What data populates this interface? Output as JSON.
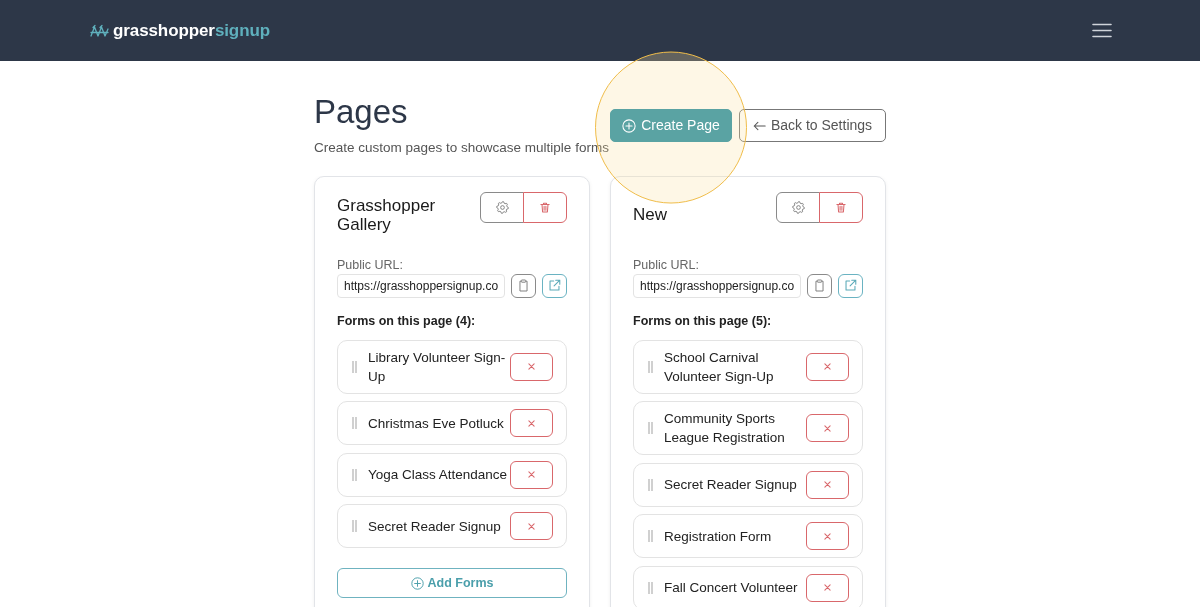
{
  "navbar": {
    "brand": {
      "name": "grasshopper",
      "suffix": "signup"
    }
  },
  "header": {
    "title": "Pages",
    "subtitle": "Create custom pages to showcase multiple forms",
    "actions": [
      {
        "label": "Create Page",
        "kind": "primary",
        "highlighted": true
      },
      {
        "label": "Back to Settings",
        "kind": "back",
        "highlighted": false
      }
    ]
  },
  "pages": [
    {
      "title": "Grasshopper Gallery",
      "url_label": "Public URL:",
      "url": "https://grasshoppersignup.co",
      "forms_heading": "Forms on this page (4):",
      "forms": [
        "Library Volunteer Sign-Up",
        "Christmas Eve Potluck",
        "Yoga Class Attendance",
        "Secret Reader Signup"
      ],
      "add_button": "Add Forms"
    },
    {
      "title": "New",
      "url_label": "Public URL:",
      "url": "https://grasshoppersignup.co",
      "forms_heading": "Forms on this page (5):",
      "forms": [
        "School Carnival Volunteer Sign-Up",
        "Community Sports League Registration",
        "Secret Reader Signup",
        "Registration Form",
        "Fall Concert Volunteer"
      ]
    }
  ]
}
